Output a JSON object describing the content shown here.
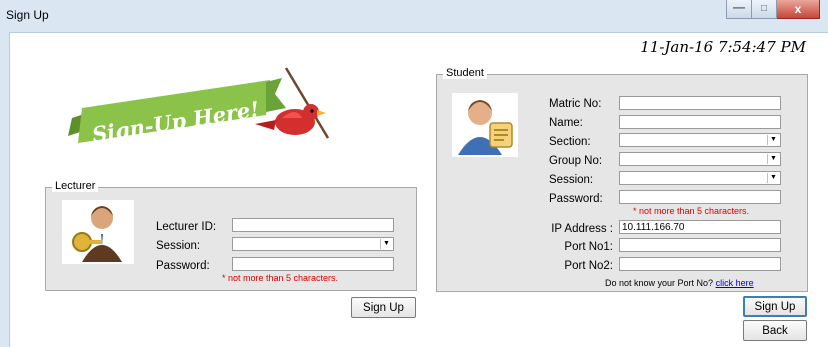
{
  "window": {
    "title": "Sign Up",
    "min_glyph": "—",
    "max_glyph": "□",
    "close_glyph": "x"
  },
  "datetime": "11-Jan-16 7:54:47 PM",
  "banner": {
    "text": "Sign-Up Here!"
  },
  "lecturer": {
    "legend": "Lecturer",
    "id_label": "Lecturer ID:",
    "session_label": "Session:",
    "password_label": "Password:",
    "id_value": "",
    "session_value": "",
    "password_value": "",
    "warning": "* not more than 5 characters."
  },
  "lecturer_signup_button": "Sign Up",
  "student": {
    "legend": "Student",
    "matric_label": "Matric No:",
    "name_label": "Name:",
    "section_label": "Section:",
    "group_label": "Group No:",
    "session_label": "Session:",
    "password_label": "Password:",
    "warning": "* not more than 5 characters.",
    "ip_label": "IP Address :",
    "ip_value": "10.111.166.70",
    "port1_label": "Port No1:",
    "port2_label": "Port No2:",
    "hint": "Do not know your Port No?",
    "hint_link": "click here"
  },
  "student_signup_button": "Sign Up",
  "back_button": "Back",
  "colors": {
    "accent": "#3c7fb1",
    "warning": "#e00000",
    "banner_green": "#8bc34a",
    "bird_red": "#d32f2f"
  }
}
